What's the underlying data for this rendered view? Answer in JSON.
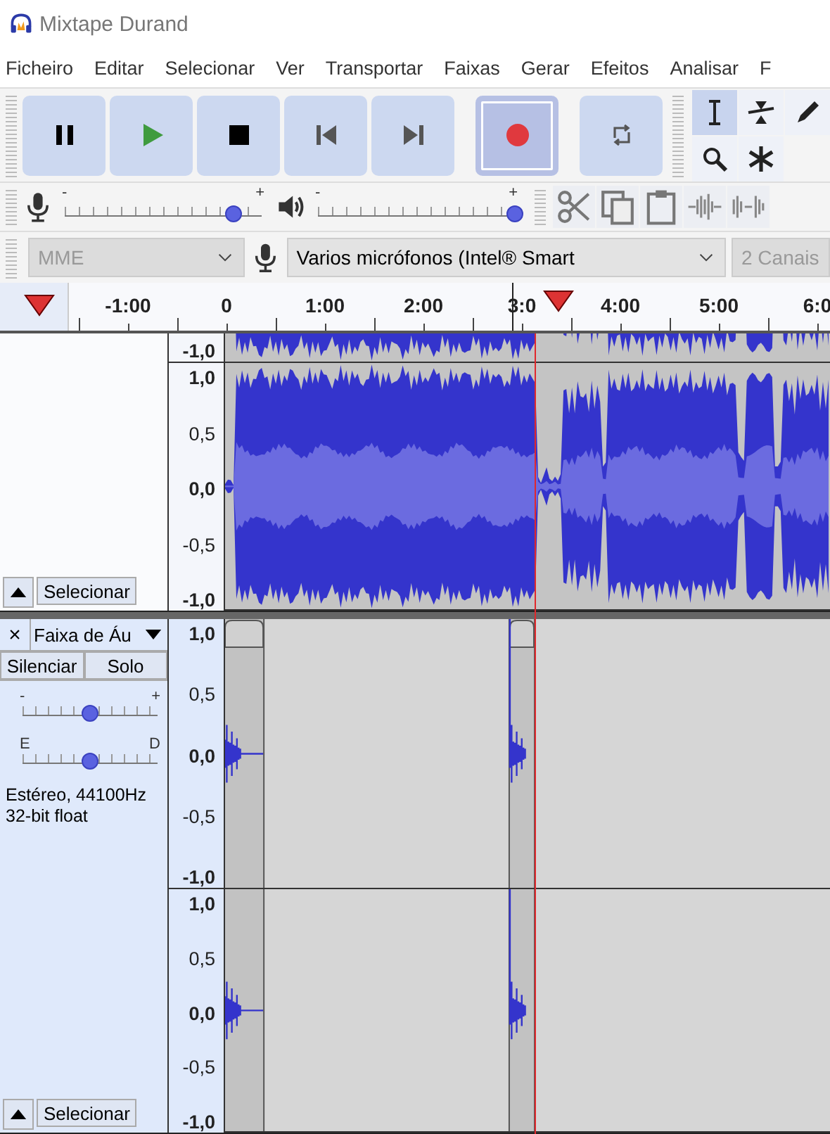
{
  "window": {
    "title": "Mixtape Durand"
  },
  "menu": [
    "Ficheiro",
    "Editar",
    "Selecionar",
    "Ver",
    "Transportar",
    "Faixas",
    "Gerar",
    "Efeitos",
    "Analisar",
    "F"
  ],
  "transport": [
    {
      "kind": "pause",
      "selected": false
    },
    {
      "kind": "play",
      "selected": false
    },
    {
      "kind": "stop",
      "selected": false
    },
    {
      "kind": "skip-start",
      "selected": false
    },
    {
      "kind": "skip-end",
      "selected": false
    },
    {
      "kind": "record",
      "selected": true
    },
    {
      "kind": "loop",
      "selected": false
    }
  ],
  "tools": [
    {
      "kind": "select",
      "selected": true
    },
    {
      "kind": "envelope",
      "selected": false
    },
    {
      "kind": "draw",
      "selected": false
    },
    {
      "kind": "zoom",
      "selected": false
    },
    {
      "kind": "multi",
      "selected": false
    }
  ],
  "meters": [
    {
      "kind": "mic",
      "minus": "-",
      "plus": "+",
      "level": 0.86
    },
    {
      "kind": "speaker",
      "minus": "-",
      "plus": "+",
      "level": 1
    }
  ],
  "edit_tools": [
    {
      "kind": "cut"
    },
    {
      "kind": "copy"
    },
    {
      "kind": "paste"
    },
    {
      "kind": "trim"
    },
    {
      "kind": "silence"
    }
  ],
  "devices": {
    "host": {
      "value": "MME",
      "disabled": true
    },
    "input": {
      "value": "Varios micrófonos (Intel® Smart",
      "disabled": false
    },
    "channels": {
      "value": "2 Canais",
      "disabled": true
    }
  },
  "timeline": {
    "ticks": [
      "-1:00",
      "0",
      "1:00",
      "2:00",
      "3:0",
      "4:00",
      "5:00",
      "6:0"
    ]
  },
  "tracks": [
    {
      "kind": "music",
      "selected": false,
      "select_button": "Selecionar",
      "channels": [
        {
          "scale": [
            "-1,0"
          ]
        },
        {
          "scale": [
            "1,0",
            "0,5",
            "0,0",
            "-0,5",
            "-1,0"
          ]
        }
      ]
    },
    {
      "kind": "clips",
      "selected": true,
      "close": "×",
      "name": "Faixa de Áu",
      "mute": "Silenciar",
      "solo": "Solo",
      "gain": {
        "minus": "-",
        "plus": "+",
        "level": 0.5
      },
      "pan": {
        "left": "E",
        "right": "D",
        "level": 0.5
      },
      "info": [
        "Estéreo, 44100Hz",
        "32-bit float"
      ],
      "select_button": "Selecionar",
      "channels": [
        {
          "scale": [
            "1,0",
            "0,5",
            "0,0",
            "-0,5",
            "-1,0"
          ]
        },
        {
          "scale": [
            "1,0",
            "0,5",
            "0,0",
            "-0,5",
            "-1,0"
          ]
        }
      ]
    }
  ]
}
